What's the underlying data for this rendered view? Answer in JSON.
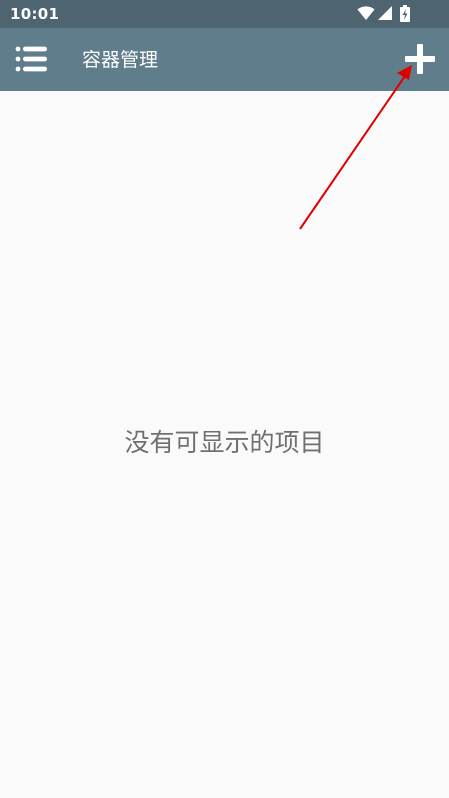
{
  "status_bar": {
    "time": "10:01"
  },
  "app_bar": {
    "title": "容器管理",
    "menu_icon": "list-menu-icon",
    "add_icon": "plus-icon"
  },
  "content": {
    "empty_message": "没有可显示的项目"
  },
  "colors": {
    "status_bar": "#4e6470",
    "app_bar": "#5f7d8b",
    "background": "#fafafa",
    "empty_text": "#707070",
    "annotation_arrow": "#e00000"
  }
}
